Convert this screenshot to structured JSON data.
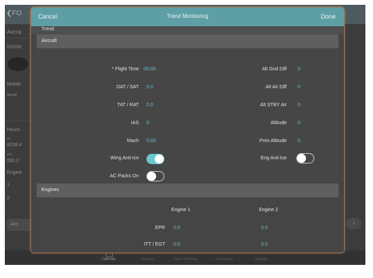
{
  "background": {
    "back_label": "FO",
    "side_labels": [
      "Aircra",
      "N103X",
      "Mobile",
      "Aircraf",
      "Hours",
      "AB",
      "8238.4",
      "APU",
      "550.0",
      "Engine",
      "1",
      "2"
    ],
    "bottom_pill": "Airc",
    "tabs": [
      "Calendar",
      "Airports",
      "Flight Planning",
      "Documents",
      "Settings"
    ]
  },
  "modal": {
    "cancel": "Cancel",
    "title": "Trend Monitoring",
    "done": "Done",
    "trend_label": "Trend",
    "aircraft_section": "Aircraft",
    "engines_section": "Engines"
  },
  "fields": {
    "flight_time": {
      "label": "* Flight Time",
      "value": "00:00"
    },
    "oat_sat": {
      "label": "OAT / SAT",
      "value": "0.0"
    },
    "tat_rat": {
      "label": "TAT / RAT",
      "value": "0.0"
    },
    "ias": {
      "label": "IAS",
      "value": "0"
    },
    "mach": {
      "label": "Mach",
      "value": "0.00"
    },
    "wing_anti_ice": {
      "label": "Wing Anti-Ice",
      "on": true
    },
    "ac_packs_on": {
      "label": "AC Packs On",
      "on": false
    },
    "alt_gnd_diff": {
      "label": "Alt Gnd Diff",
      "value": "0"
    },
    "alt_air_diff": {
      "label": "Alt Air Diff",
      "value": "0"
    },
    "alt_stby_air": {
      "label": "Alt STBY Air",
      "value": "0"
    },
    "altitude": {
      "label": "Altitude",
      "value": "0"
    },
    "pres_altitude": {
      "label": "Pres Altitude",
      "value": "0"
    },
    "eng_anti_ice": {
      "label": "Eng Anti-Ice",
      "on": false
    }
  },
  "engines": {
    "headers": [
      "Engine 1",
      "Engine 2"
    ],
    "rows": [
      {
        "label": "EPR",
        "values": [
          "0.0",
          "0.0"
        ]
      },
      {
        "label": "ITT / EGT",
        "values": [
          "0.0",
          "0.0"
        ]
      }
    ]
  },
  "colors": {
    "accent": "#5e9fa6",
    "value_text": "#6cc0cc",
    "toggle_on": "#6cc6d2",
    "modal_glow": "#c58b60"
  }
}
